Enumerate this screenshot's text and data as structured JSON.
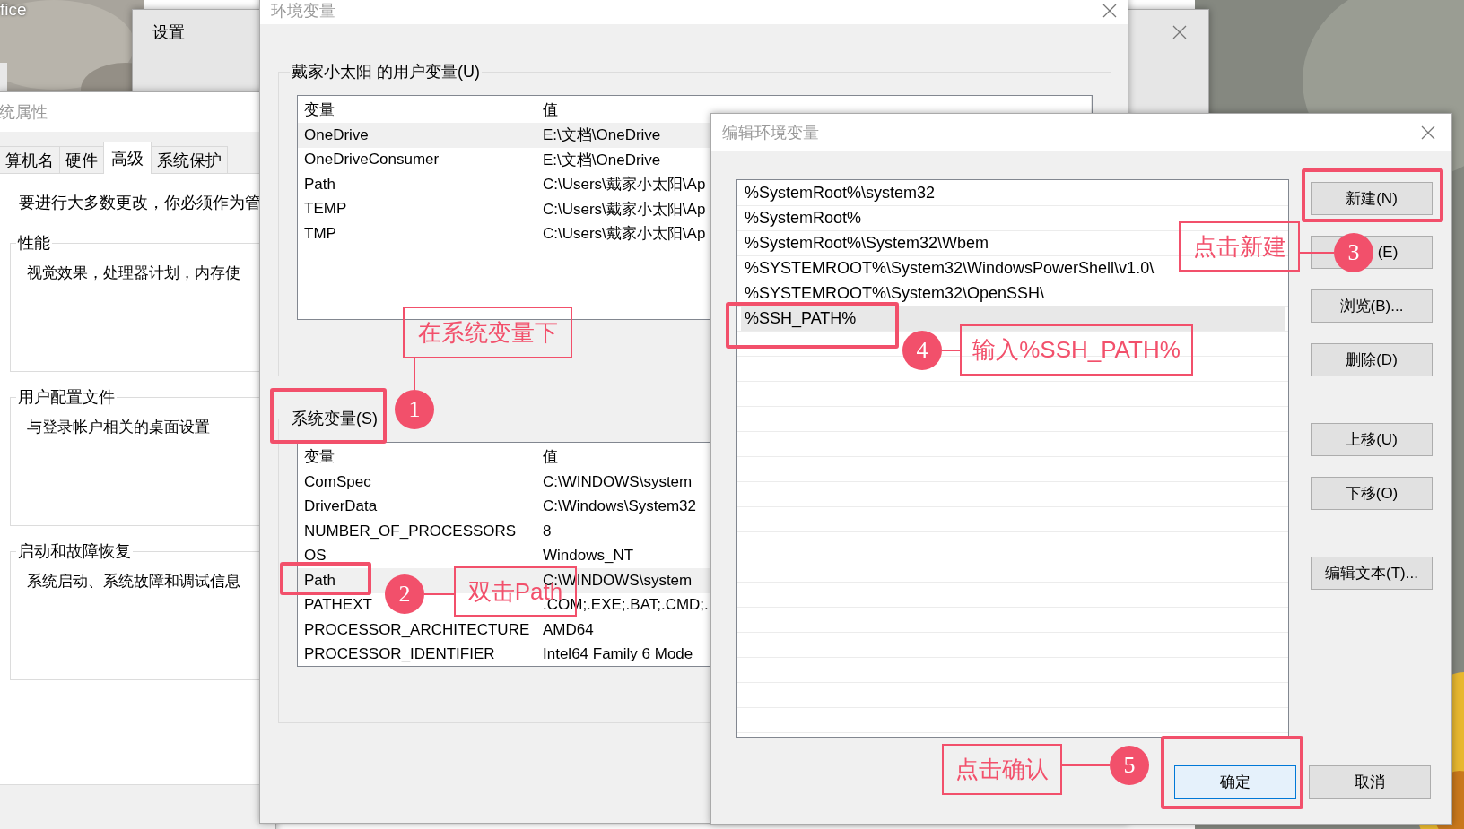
{
  "desktop_text": "fice",
  "settings_window": {
    "title": "设置"
  },
  "system_properties": {
    "title": "统属性",
    "tabs": [
      {
        "label": "算机名",
        "selected": false
      },
      {
        "label": "硬件",
        "selected": false
      },
      {
        "label": "高级",
        "selected": true
      },
      {
        "label": "系统保护",
        "selected": false
      }
    ],
    "notice": "要进行大多数更改，你必须作为管",
    "groups": [
      {
        "title": "性能",
        "text": "视觉效果，处理器计划，内存使"
      },
      {
        "title": "用户配置文件",
        "text": "与登录帐户相关的桌面设置"
      },
      {
        "title": "启动和故障恢复",
        "text": "系统启动、系统故障和调试信息"
      }
    ]
  },
  "env_window": {
    "title": "环境变量",
    "user_group": {
      "title": "戴家小太阳 的用户变量(U)",
      "columns": [
        "变量",
        "值"
      ],
      "rows": [
        {
          "name": "OneDrive",
          "value": "E:\\文档\\OneDrive",
          "selected": true
        },
        {
          "name": "OneDriveConsumer",
          "value": "E:\\文档\\OneDrive",
          "selected": false
        },
        {
          "name": "Path",
          "value": "C:\\Users\\戴家小太阳\\Ap",
          "selected": false
        },
        {
          "name": "TEMP",
          "value": "C:\\Users\\戴家小太阳\\Ap",
          "selected": false
        },
        {
          "name": "TMP",
          "value": "C:\\Users\\戴家小太阳\\Ap",
          "selected": false
        }
      ]
    },
    "system_group": {
      "title": "系统变量(S)",
      "columns": [
        "变量",
        "值"
      ],
      "rows": [
        {
          "name": "ComSpec",
          "value": "C:\\WINDOWS\\system",
          "selected": false
        },
        {
          "name": "DriverData",
          "value": "C:\\Windows\\System32",
          "selected": false
        },
        {
          "name": "NUMBER_OF_PROCESSORS",
          "value": "8",
          "selected": false
        },
        {
          "name": "OS",
          "value": "Windows_NT",
          "selected": false
        },
        {
          "name": "Path",
          "value": "C:\\WINDOWS\\system",
          "selected": true
        },
        {
          "name": "PATHEXT",
          "value": ".COM;.EXE;.BAT;.CMD;.",
          "selected": false
        },
        {
          "name": "PROCESSOR_ARCHITECTURE",
          "value": "AMD64",
          "selected": false
        },
        {
          "name": "PROCESSOR_IDENTIFIER",
          "value": "Intel64 Family 6 Mode",
          "selected": false
        }
      ]
    }
  },
  "edit_dialog": {
    "title": "编辑环境变量",
    "entries": [
      {
        "text": "%SystemRoot%\\system32",
        "selected": false
      },
      {
        "text": "%SystemRoot%",
        "selected": false
      },
      {
        "text": "%SystemRoot%\\System32\\Wbem",
        "selected": false
      },
      {
        "text": "%SYSTEMROOT%\\System32\\WindowsPowerShell\\v1.0\\",
        "selected": false
      },
      {
        "text": "%SYSTEMROOT%\\System32\\OpenSSH\\",
        "selected": false
      },
      {
        "text": "%SSH_PATH%",
        "selected": true
      }
    ],
    "button_groups": [
      [
        "新建(N)",
        "(E)",
        "浏览(B)...",
        "删除(D)"
      ],
      [
        "上移(U)",
        "下移(O)"
      ],
      [
        "编辑文本(T)..."
      ]
    ],
    "ok_button": "确定",
    "cancel_button": "取消"
  },
  "annotations": [
    {
      "step": "1",
      "text": "在系统变量下"
    },
    {
      "step": "2",
      "text": "双击Path"
    },
    {
      "step": "3",
      "text": "点击新建"
    },
    {
      "step": "4",
      "text": "输入%SSH_PATH%"
    },
    {
      "step": "5",
      "text": "点击确认"
    }
  ]
}
